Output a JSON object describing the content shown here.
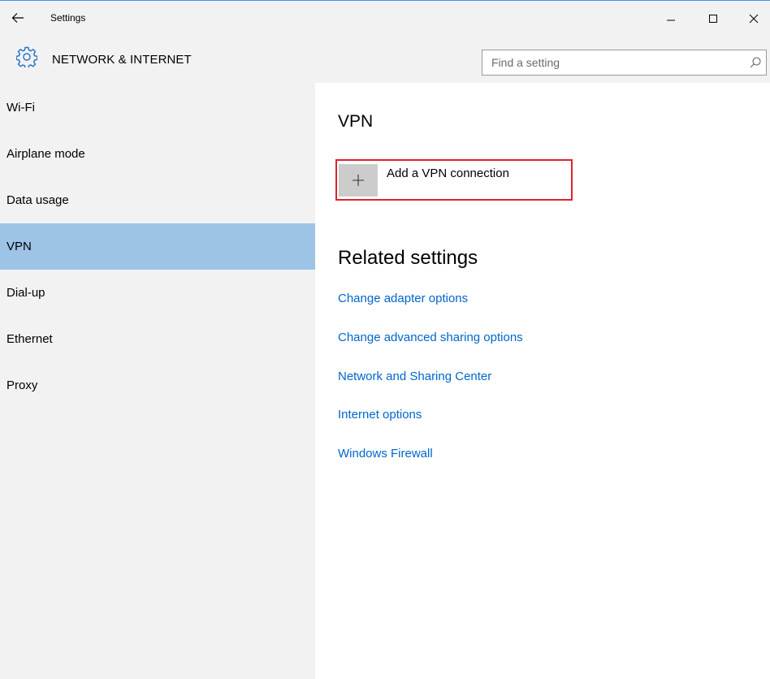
{
  "window": {
    "title": "Settings",
    "controls": {
      "minimize": "–",
      "maximize": "□",
      "close": "✕"
    }
  },
  "header": {
    "title": "NETWORK & INTERNET",
    "icon": "gear-icon",
    "search": {
      "placeholder": "Find a setting",
      "value": ""
    }
  },
  "sidebar": {
    "items": [
      {
        "label": "Wi-Fi",
        "active": false
      },
      {
        "label": "Airplane mode",
        "active": false
      },
      {
        "label": "Data usage",
        "active": false
      },
      {
        "label": "VPN",
        "active": true
      },
      {
        "label": "Dial-up",
        "active": false
      },
      {
        "label": "Ethernet",
        "active": false
      },
      {
        "label": "Proxy",
        "active": false
      }
    ]
  },
  "main": {
    "vpn_title": "VPN",
    "add_vpn": {
      "label": "Add a VPN connection",
      "icon": "plus-icon",
      "highlight_color": "#e0232d"
    },
    "related_title": "Related settings",
    "links": [
      "Change adapter options",
      "Change advanced sharing options",
      "Network and Sharing Center",
      "Internet options",
      "Windows Firewall"
    ]
  },
  "colors": {
    "accent": "#0066cc",
    "active_nav": "#9dc3e6",
    "chrome_bg": "#f2f2f2",
    "icon_blue": "#1f6fc5"
  }
}
